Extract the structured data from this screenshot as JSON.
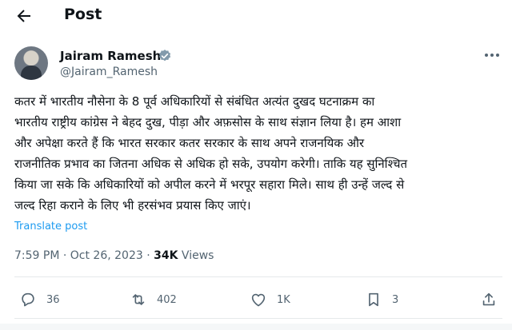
{
  "header": {
    "title": "Post"
  },
  "author": {
    "name": "Jairam Ramesh",
    "handle": "@Jairam_Ramesh"
  },
  "post": {
    "text": "कतर में भारतीय नौसेना के 8 पूर्व अधिकारियों से संबंधित अत्यंत दुखद घटनाक्रम का\nभारतीय राष्ट्रीय कांग्रेस ने बेहद दुख, पीड़ा और अफ़सोस के साथ संज्ञान लिया है। हम आशा\nऔर अपेक्षा करते हैं कि भारत सरकार कतर सरकार के साथ अपने राजनयिक और\nराजनीतिक प्रभाव का जितना अधिक से अधिक हो सके, उपयोग करेगी। ताकि यह सुनिश्चित\nकिया जा सके कि अधिकारियों को अपील करने में भरपूर सहारा मिले। साथ ही उन्हें जल्द से\nजल्द रिहा कराने के लिए भी हरसंभव प्रयास किए जाएं।",
    "translate_label": "Translate post",
    "time": "7:59 PM · Oct 26, 2023 · ",
    "views_count": "34K",
    "views_label": " Views"
  },
  "actions": {
    "replies": "36",
    "reposts": "402",
    "likes": "1K",
    "bookmarks": "3"
  },
  "icons": {
    "back": "arrow-left-icon",
    "verified": "verified-badge-icon",
    "more": "more-icon",
    "reply": "reply-icon",
    "repost": "repost-icon",
    "like": "heart-icon",
    "bookmark": "bookmark-icon",
    "share": "share-icon"
  },
  "colors": {
    "accent": "#1d9bf0",
    "muted": "#536471",
    "text": "#0f1419"
  }
}
